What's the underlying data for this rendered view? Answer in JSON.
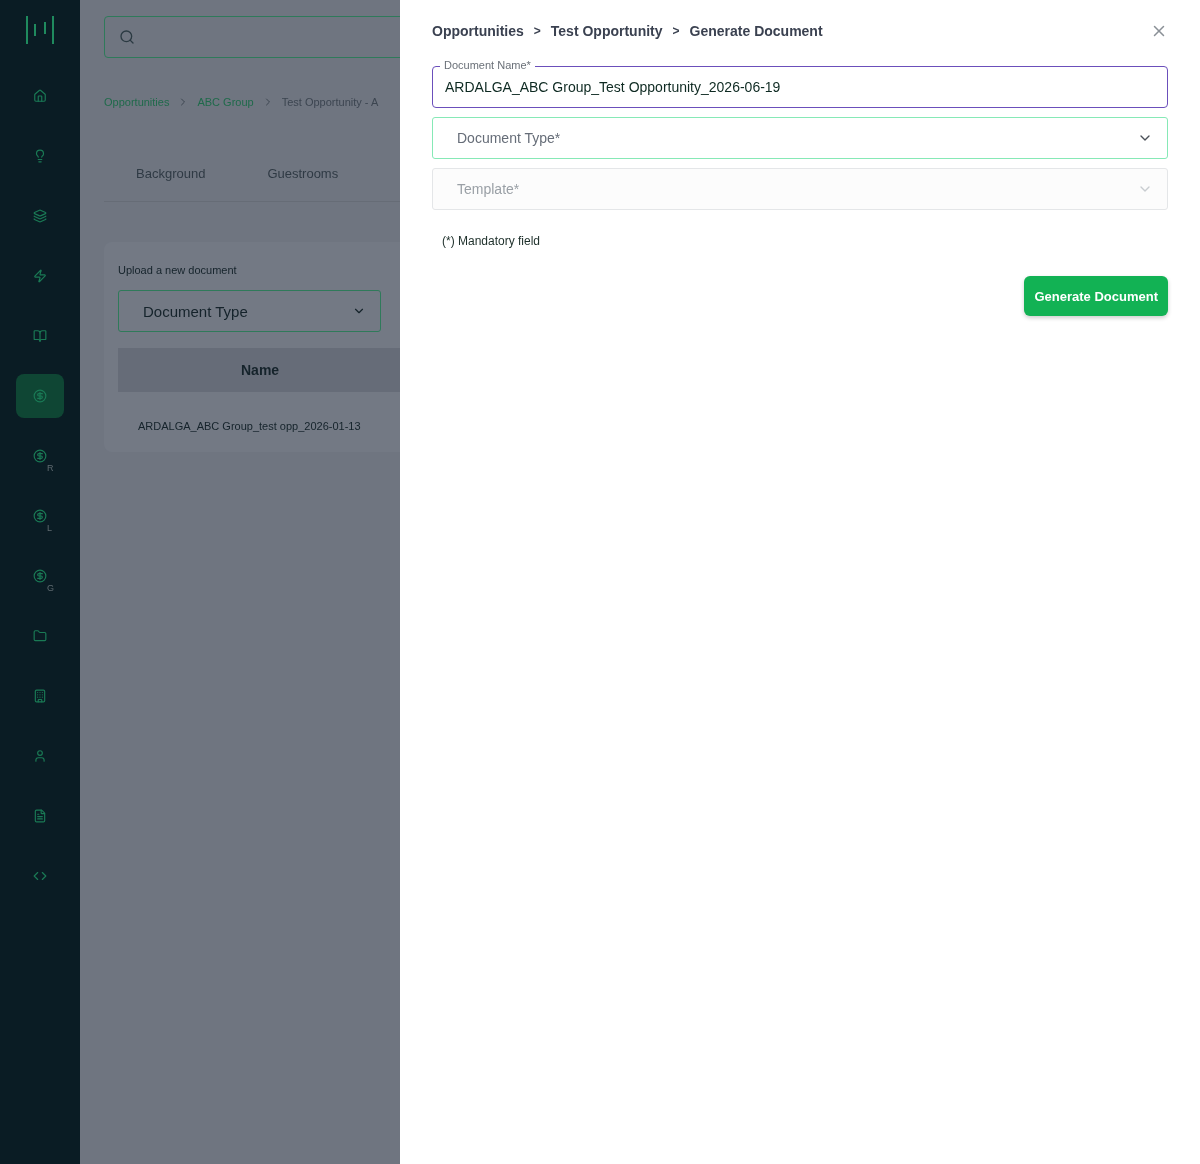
{
  "sidebar": {
    "items": [
      {
        "kind": "home",
        "selected": false
      },
      {
        "kind": "bulb",
        "selected": false
      },
      {
        "kind": "layers",
        "selected": false
      },
      {
        "kind": "zap",
        "selected": false
      },
      {
        "kind": "book",
        "selected": false
      },
      {
        "kind": "dollar",
        "selected": true
      },
      {
        "kind": "dollar",
        "suffix": "R",
        "selected": false
      },
      {
        "kind": "dollar",
        "suffix": "L",
        "selected": false
      },
      {
        "kind": "dollar",
        "suffix": "G",
        "selected": false
      },
      {
        "kind": "folder",
        "selected": false
      },
      {
        "kind": "building",
        "selected": false
      },
      {
        "kind": "user",
        "selected": false
      },
      {
        "kind": "file",
        "selected": false
      },
      {
        "kind": "code",
        "selected": false
      }
    ]
  },
  "page": {
    "breadcrumb": [
      {
        "label": "Opportunities",
        "link": true
      },
      {
        "label": "ABC Group",
        "link": true
      },
      {
        "label": "Test Opportunity - A",
        "link": false
      }
    ],
    "tabs": [
      {
        "label": "Background",
        "selected": false
      },
      {
        "label": "Guestrooms",
        "selected": false
      }
    ],
    "upload_card": {
      "title": "Upload a new document",
      "select": {
        "placeholder": "Document Type"
      },
      "table": {
        "columns": [
          "Name"
        ],
        "rows": [
          [
            "ARDALGA_ABC Group_test opp_2026-01-13"
          ]
        ]
      }
    }
  },
  "drawer": {
    "breadcrumb": [
      "Opportunities",
      "Test Opportunity",
      "Generate Document"
    ],
    "separator": ">",
    "fields": [
      {
        "kind": "text",
        "label": "Document Name*",
        "value": "ARDALGA_ABC Group_Test Opportunity_2026-06-19",
        "focused": true
      },
      {
        "kind": "select",
        "placeholder": "Document Type*",
        "focused": true,
        "disabled": false
      },
      {
        "kind": "select",
        "placeholder": "Template*",
        "focused": false,
        "disabled": true
      }
    ],
    "note": "(*) Mandatory field",
    "button": "Generate Document"
  }
}
